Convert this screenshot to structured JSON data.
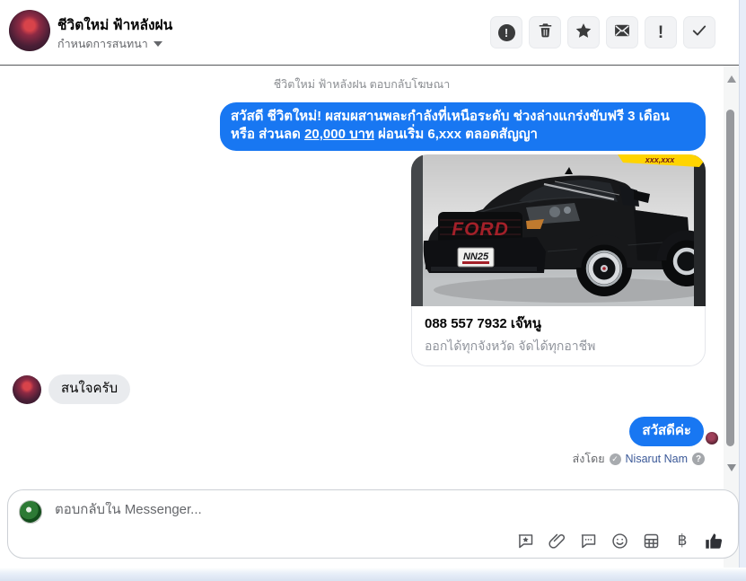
{
  "header": {
    "title": "ชีวิตใหม่ ฟ้าหลังฝน",
    "subtitle": "กำหนดการสนทนา",
    "action_icons": [
      "report-icon",
      "trash-icon",
      "star-icon",
      "mark-unread-icon",
      "important-icon",
      "done-check-icon"
    ]
  },
  "thread": {
    "context_label": "ชีวิตใหม่ ฟ้าหลังฝน ตอบกลับโฆษณา",
    "ad_message": {
      "text_before_discount": "สวัสดี ชีวิตใหม่! ผสมผสานพละกำลังที่เหนือระดับ ช่วงล่างแกร่งขับฟรี 3 เดือน หรือ ส่วนลด ",
      "discount_underlined": "20,000 บาท",
      "text_after_discount": " ผ่อนเริ่ม 6,xxx ตลอดสัญญา"
    },
    "ad_card": {
      "banner_text": "xxx,xxx",
      "grille_text": "FORD",
      "license_plate": "NN25",
      "title": "088 557 7932 เจ๊หนู",
      "subtitle": "ออกได้ทุกจังหวัด จัดได้ทุกอาชีพ"
    },
    "incoming_message": {
      "text": "สนใจครับ"
    },
    "outgoing_message": {
      "text": "สวัสดีค่ะ"
    },
    "sent_by": {
      "prefix": "ส่งโดย",
      "badge_icon": "agent-badge-icon",
      "agent_name": "Nisarut Nam",
      "help_icon": "help-icon",
      "help_glyph": "?"
    }
  },
  "composer": {
    "placeholder": "ตอบกลับใน Messenger...",
    "baht_symbol": "฿",
    "tool_icons": [
      "saved-replies-icon",
      "paperclip-icon",
      "comment-icon",
      "emoji-icon",
      "payment-grid-icon",
      "baht-icon",
      "like-thumb-icon"
    ]
  },
  "scrollbar_icons": [
    "scroll-up-icon",
    "scroll-down-icon"
  ],
  "colors": {
    "bubble_blue": "#1877f2",
    "link_blue": "#3b5998",
    "muted_text": "#65676b",
    "banner_yellow": "#ffd400",
    "grille_red": "#a32029"
  }
}
